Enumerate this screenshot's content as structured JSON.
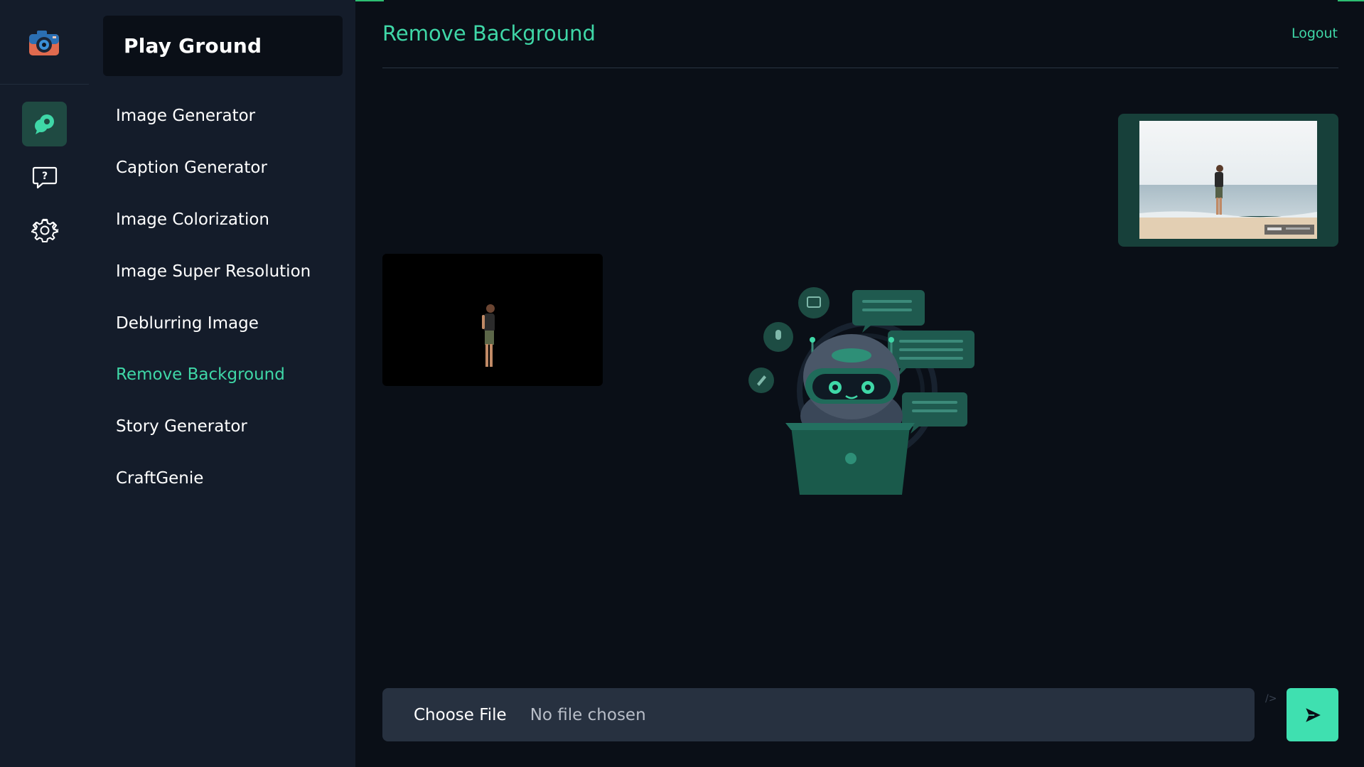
{
  "app": {
    "brand_title": "Play Ground",
    "logo_icon": "camera-logo-icon",
    "accent_color": "#3fd7a7"
  },
  "rail": {
    "items": [
      {
        "icon": "chat-bubbles-icon",
        "active": true
      },
      {
        "icon": "help-bubble-icon",
        "active": false
      },
      {
        "icon": "gear-icon",
        "active": false
      }
    ]
  },
  "sidebar": {
    "items": [
      {
        "label": "Image Generator"
      },
      {
        "label": "Caption Generator"
      },
      {
        "label": "Image Colorization"
      },
      {
        "label": "Image Super Resolution"
      },
      {
        "label": "Deblurring Image"
      },
      {
        "label": "Remove Background",
        "active": true
      },
      {
        "label": "Story Generator"
      },
      {
        "label": "CraftGenie"
      }
    ]
  },
  "header": {
    "title": "Remove Background",
    "logout_label": "Logout"
  },
  "upload": {
    "choose_label": "Choose File",
    "status": "No file chosen",
    "ghost_text": "/>",
    "send_icon": "send-arrow-icon"
  },
  "images": {
    "input_image": "beach-person-photo",
    "output_image": "background-removed-person",
    "illustration": "robot-laptop-illustration"
  }
}
